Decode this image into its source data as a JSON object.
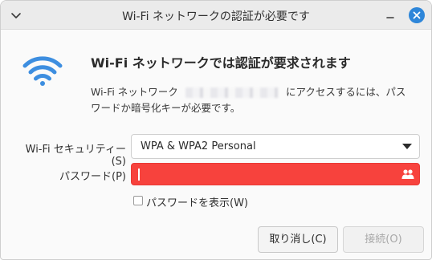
{
  "window": {
    "title": "Wi-Fi ネットワークの認証が必要です",
    "accent_color": "#2e86d9"
  },
  "icons": {
    "window_menu": "chevron-down-icon",
    "minimize": "minimize-icon",
    "close": "close-icon",
    "network": "wifi-icon",
    "password_storage": "users-icon"
  },
  "dialog": {
    "heading": "Wi-Fi ネットワークでは認証が要求されます",
    "description_prefix": "Wi-Fi ネットワーク",
    "description_after": "にアクセスするには、パス",
    "description_line2": "ワードか暗号化キーが必要です。"
  },
  "form": {
    "security_label": "Wi-Fi セキュリティー(S)",
    "security_value": "WPA & WPA2 Personal",
    "password_label": "パスワード(P)",
    "password_value": "",
    "password_error_color": "#f7423d",
    "show_password_label": "パスワードを表示(W)",
    "show_password_checked": false
  },
  "buttons": {
    "cancel": "取り消し(C)",
    "connect": "接続(O)",
    "connect_enabled": false
  }
}
